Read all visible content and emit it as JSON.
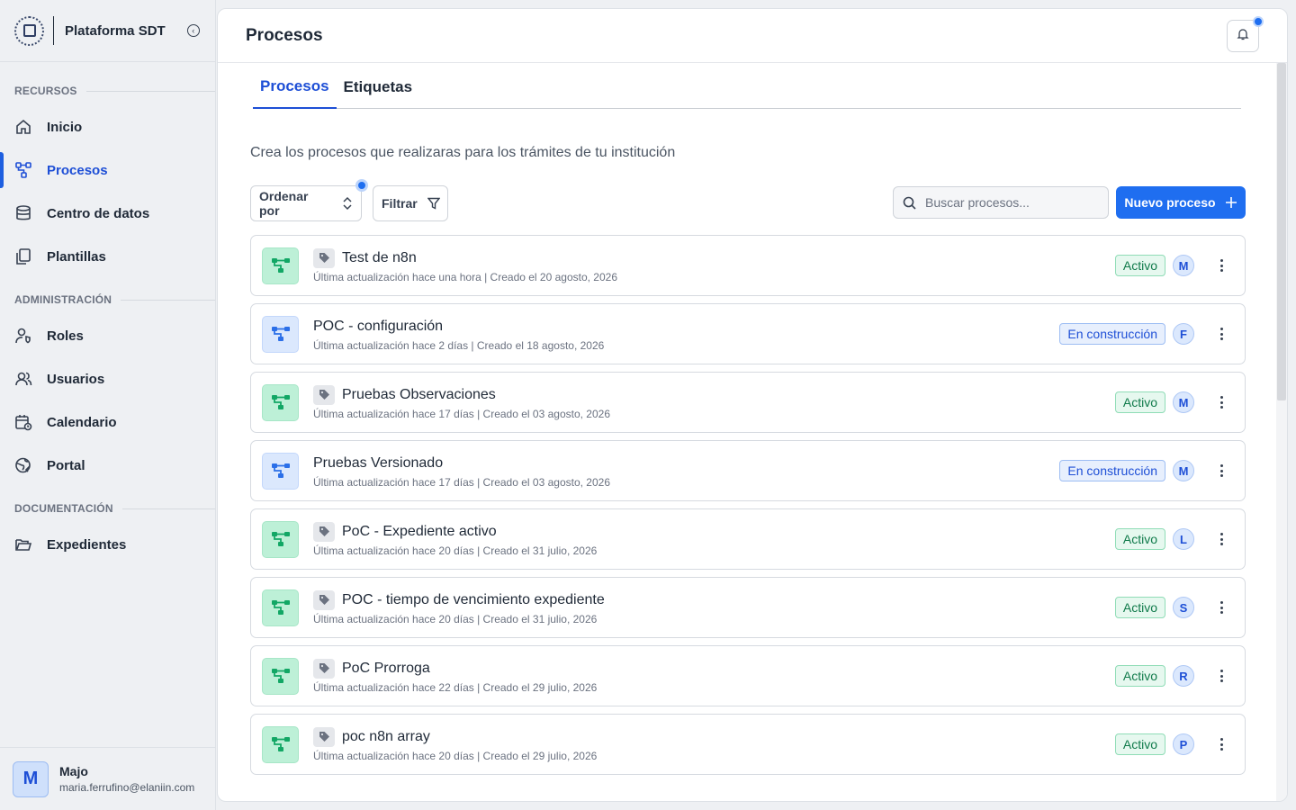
{
  "sidebar": {
    "brand_name": "Plataforma SDT",
    "sections": [
      {
        "title": "RECURSOS"
      },
      {
        "title": "ADMINISTRACIÓN"
      },
      {
        "title": "DOCUMENTACIÓN"
      }
    ],
    "items": [
      {
        "label": "Inicio",
        "icon": "home-icon"
      },
      {
        "label": "Procesos",
        "icon": "flow-icon",
        "active": true
      },
      {
        "label": "Centro de datos",
        "icon": "database-icon"
      },
      {
        "label": "Plantillas",
        "icon": "templates-icon"
      },
      {
        "label": "Roles",
        "icon": "user-shield-icon"
      },
      {
        "label": "Usuarios",
        "icon": "users-icon"
      },
      {
        "label": "Calendario",
        "icon": "calendar-icon"
      },
      {
        "label": "Portal",
        "icon": "globe-icon"
      },
      {
        "label": "Expedientes",
        "icon": "folder-icon"
      }
    ],
    "user": {
      "initial": "M",
      "name": "Majo",
      "email": "maria.ferrufino@elaniin.com"
    }
  },
  "header": {
    "title": "Procesos"
  },
  "tabs": [
    {
      "label": "Procesos",
      "active": true
    },
    {
      "label": "Etiquetas",
      "active": false
    }
  ],
  "subtitle": "Crea los procesos que realizaras para los trámites de tu institución",
  "toolbar": {
    "sort_label": "Ordenar por",
    "filter_label": "Filtrar",
    "search_placeholder": "Buscar procesos...",
    "new_label": "Nuevo proceso"
  },
  "processes": [
    {
      "title": "Test de n8n",
      "meta": "Última actualización hace una hora | Creado el 20 agosto, 2026",
      "status": "Activo",
      "owner": "M",
      "tagged": true
    },
    {
      "title": "POC - configuración",
      "meta": "Última actualización hace 2 días | Creado el 18 agosto, 2026",
      "status": "En construcción",
      "owner": "F",
      "tagged": false
    },
    {
      "title": "Pruebas Observaciones",
      "meta": "Última actualización hace 17 días | Creado el 03 agosto, 2026",
      "status": "Activo",
      "owner": "M",
      "tagged": true
    },
    {
      "title": "Pruebas Versionado",
      "meta": "Última actualización hace 17 días | Creado el 03 agosto, 2026",
      "status": "En construcción",
      "owner": "M",
      "tagged": false
    },
    {
      "title": "PoC - Expediente activo",
      "meta": "Última actualización hace 20 días | Creado el 31 julio, 2026",
      "status": "Activo",
      "owner": "L",
      "tagged": true
    },
    {
      "title": "POC - tiempo de vencimiento expediente",
      "meta": "Última actualización hace 20 días | Creado el 31 julio, 2026",
      "status": "Activo",
      "owner": "S",
      "tagged": true
    },
    {
      "title": "PoC Prorroga",
      "meta": "Última actualización hace 22 días | Creado el 29 julio, 2026",
      "status": "Activo",
      "owner": "R",
      "tagged": true
    },
    {
      "title": "poc n8n array",
      "meta": "Última actualización hace 20 días | Creado el 29 julio, 2026",
      "status": "Activo",
      "owner": "P",
      "tagged": true
    }
  ],
  "colors": {
    "accent": "#1f6ef0",
    "active_green": "#0f7a4a",
    "construct_blue": "#1e4fd6"
  }
}
